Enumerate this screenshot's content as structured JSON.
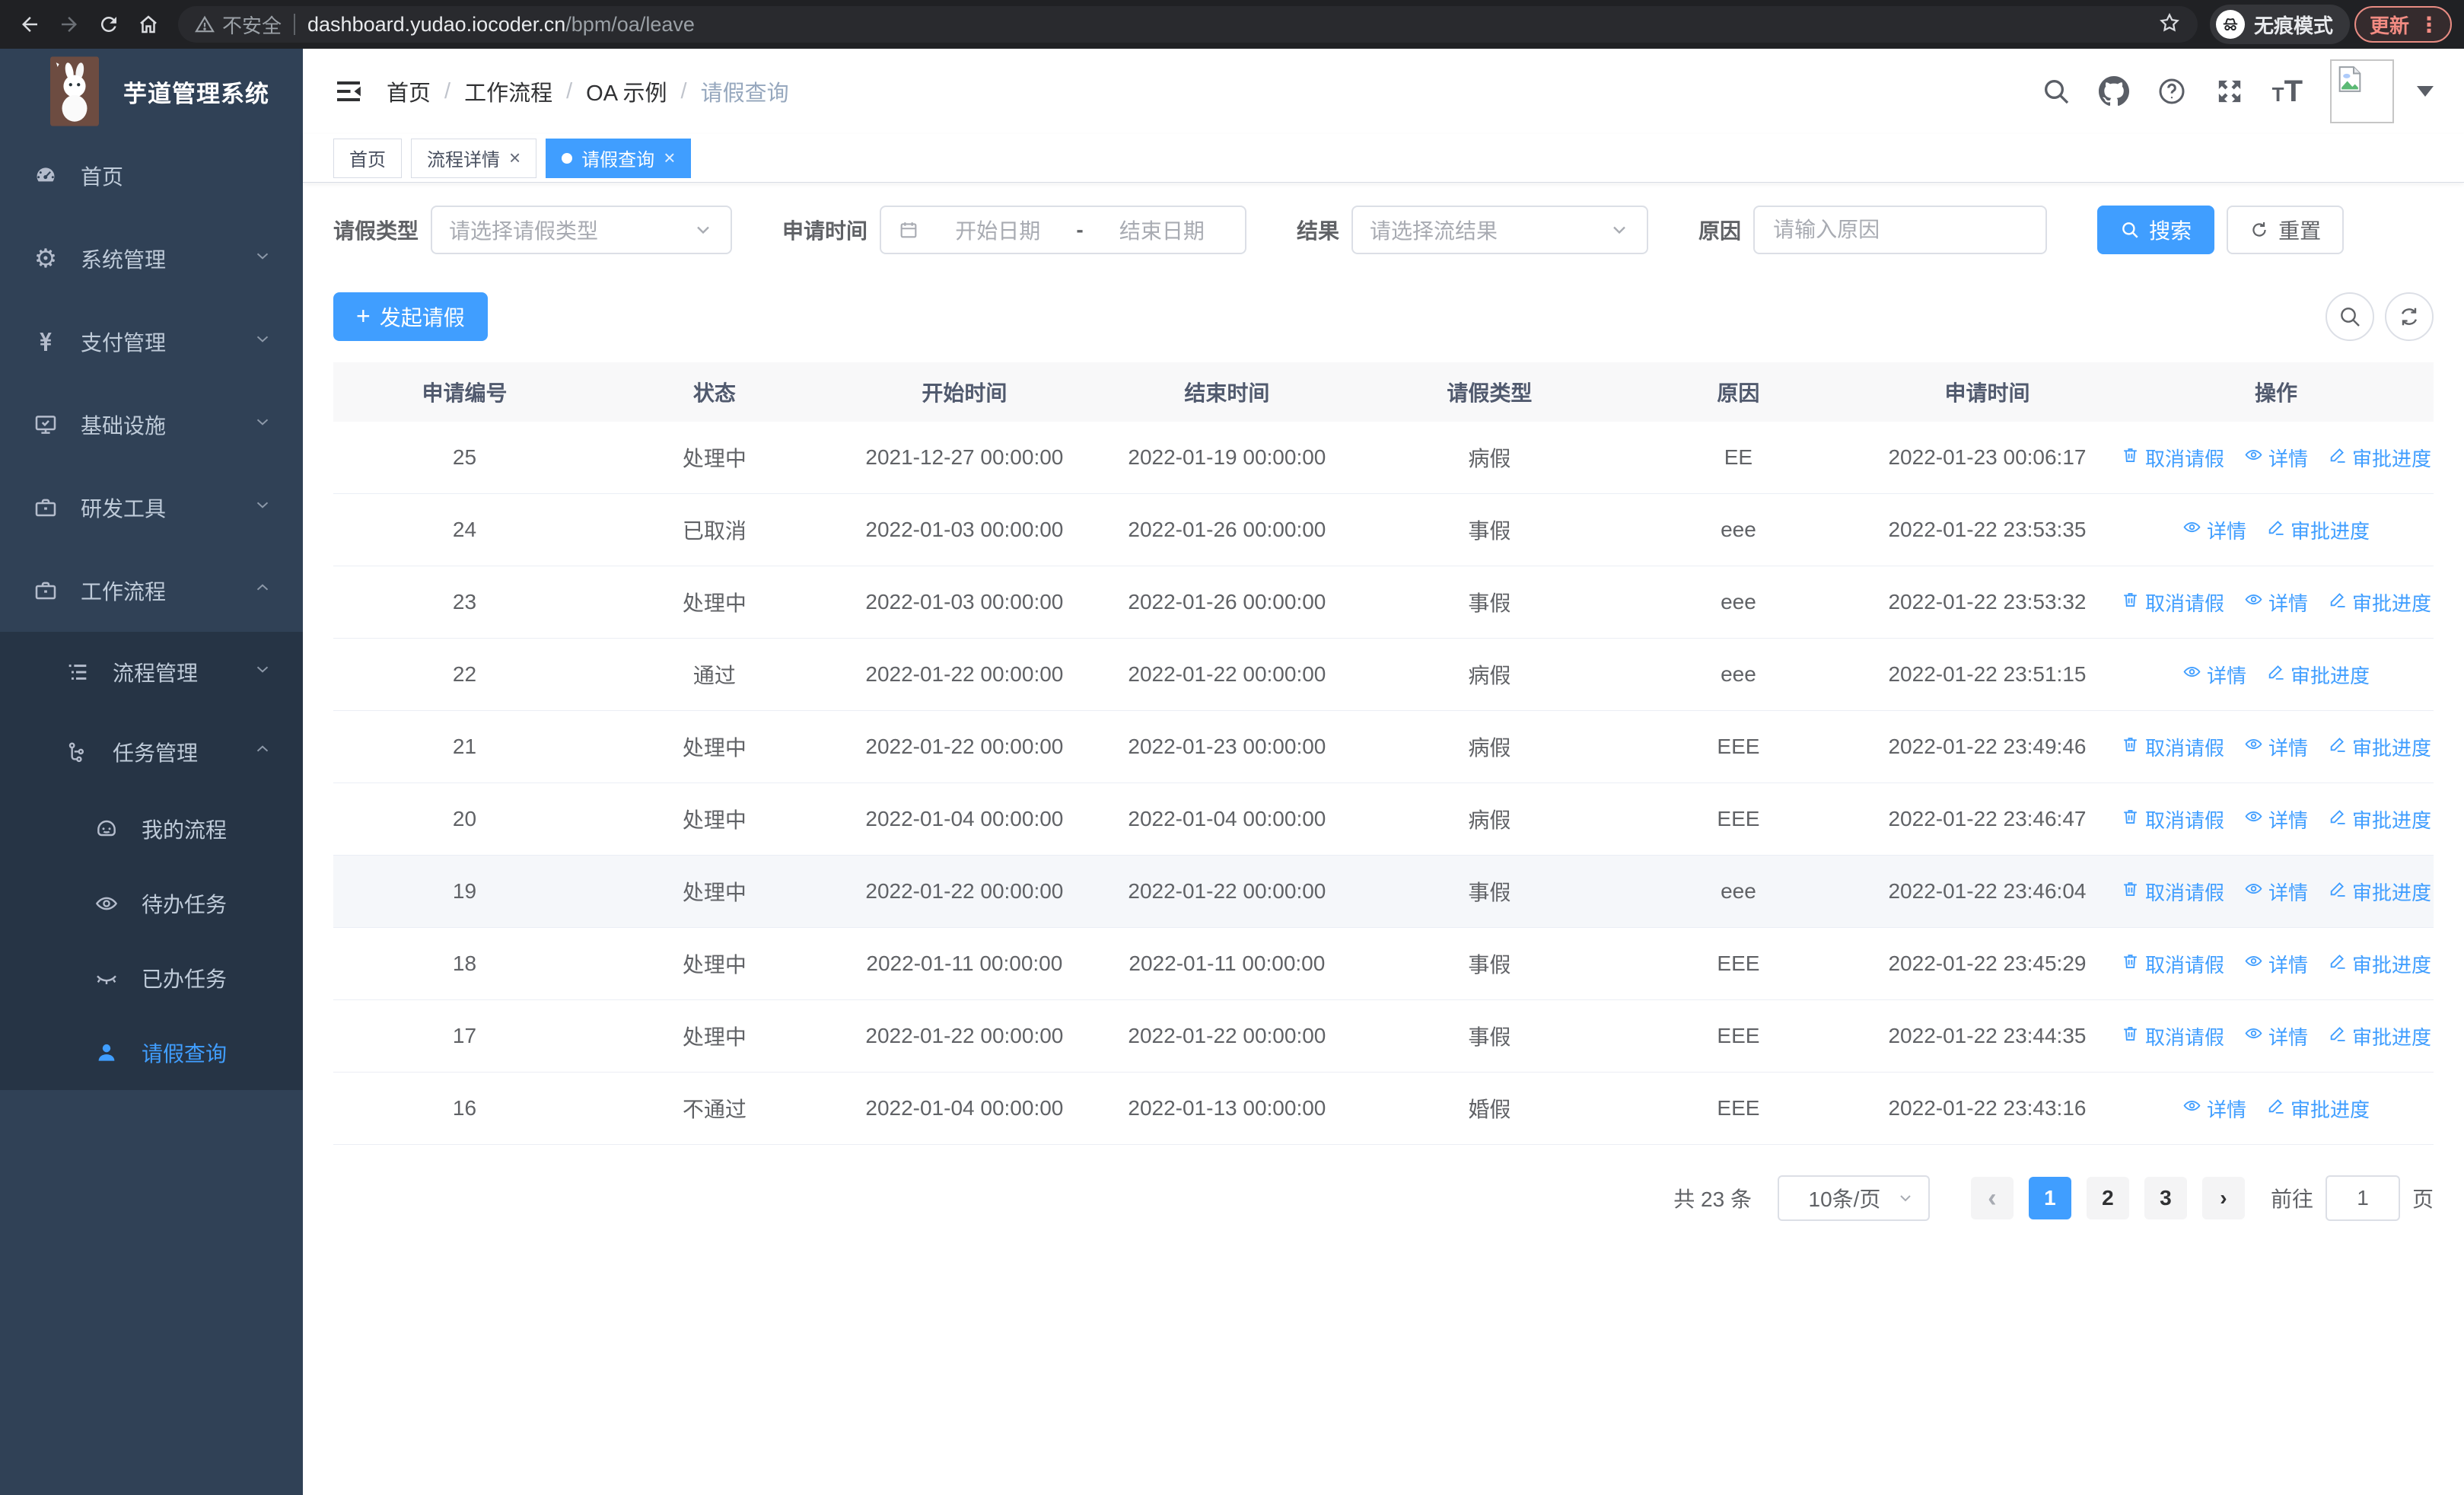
{
  "browser": {
    "security_warning": "不安全",
    "url_host": "dashboard.yudao.iocoder.cn",
    "url_path": "/bpm/oa/leave",
    "incognito_label": "无痕模式",
    "update_label": "更新",
    "menu_dots": "⋮"
  },
  "app": {
    "logo_title": "芋道管理系统",
    "breadcrumb": [
      "首页",
      "工作流程",
      "OA 示例",
      "请假查询"
    ],
    "tabs": [
      {
        "label": "首页",
        "closable": false,
        "active": false
      },
      {
        "label": "流程详情",
        "closable": true,
        "active": false
      },
      {
        "label": "请假查询",
        "closable": true,
        "active": true
      }
    ]
  },
  "sidebar": {
    "items": [
      {
        "label": "首页",
        "icon": "dashboard-icon",
        "level": 1,
        "arrow": "",
        "active": false
      },
      {
        "label": "系统管理",
        "icon": "gear-icon",
        "level": 1,
        "arrow": "down",
        "active": false
      },
      {
        "label": "支付管理",
        "icon": "yen-icon",
        "level": 1,
        "arrow": "down",
        "active": false
      },
      {
        "label": "基础设施",
        "icon": "monitor-icon",
        "level": 1,
        "arrow": "down",
        "active": false
      },
      {
        "label": "研发工具",
        "icon": "briefcase-icon",
        "level": 1,
        "arrow": "down",
        "active": false
      },
      {
        "label": "工作流程",
        "icon": "briefcase-icon",
        "level": 1,
        "arrow": "up",
        "active": false
      },
      {
        "label": "流程管理",
        "icon": "list-icon",
        "level": 2,
        "arrow": "down",
        "active": false
      },
      {
        "label": "任务管理",
        "icon": "tree-icon",
        "level": 2,
        "arrow": "up",
        "active": false
      },
      {
        "label": "我的流程",
        "icon": "face-icon",
        "level": 3,
        "arrow": "",
        "active": false
      },
      {
        "label": "待办任务",
        "icon": "eye-open-icon",
        "level": 3,
        "arrow": "",
        "active": false
      },
      {
        "label": "已办任务",
        "icon": "eye-closed-icon",
        "level": 3,
        "arrow": "",
        "active": false
      },
      {
        "label": "请假查询",
        "icon": "user-icon",
        "level": 3,
        "arrow": "",
        "active": true
      }
    ]
  },
  "filters": {
    "leave_type_label": "请假类型",
    "leave_type_placeholder": "请选择请假类型",
    "apply_time_label": "申请时间",
    "start_placeholder": "开始日期",
    "range_separator": "-",
    "end_placeholder": "结束日期",
    "result_label": "结果",
    "result_placeholder": "请选择流结果",
    "reason_label": "原因",
    "reason_placeholder": "请输入原因",
    "search_button": "搜索",
    "reset_button": "重置"
  },
  "toolbar": {
    "create_button": "发起请假"
  },
  "table": {
    "columns": [
      "申请编号",
      "状态",
      "开始时间",
      "结束时间",
      "请假类型",
      "原因",
      "申请时间",
      "操作"
    ],
    "action_labels": {
      "cancel": "取消请假",
      "detail": "详情",
      "progress": "审批进度"
    },
    "rows": [
      {
        "id": "25",
        "status": "处理中",
        "start": "2021-12-27 00:00:00",
        "end": "2022-01-19 00:00:00",
        "type": "病假",
        "reason": "EE",
        "applied": "2022-01-23 00:06:17",
        "actions": [
          "cancel",
          "detail",
          "progress"
        ],
        "highlight": false
      },
      {
        "id": "24",
        "status": "已取消",
        "start": "2022-01-03 00:00:00",
        "end": "2022-01-26 00:00:00",
        "type": "事假",
        "reason": "eee",
        "applied": "2022-01-22 23:53:35",
        "actions": [
          "detail",
          "progress"
        ],
        "highlight": false
      },
      {
        "id": "23",
        "status": "处理中",
        "start": "2022-01-03 00:00:00",
        "end": "2022-01-26 00:00:00",
        "type": "事假",
        "reason": "eee",
        "applied": "2022-01-22 23:53:32",
        "actions": [
          "cancel",
          "detail",
          "progress"
        ],
        "highlight": false
      },
      {
        "id": "22",
        "status": "通过",
        "start": "2022-01-22 00:00:00",
        "end": "2022-01-22 00:00:00",
        "type": "病假",
        "reason": "eee",
        "applied": "2022-01-22 23:51:15",
        "actions": [
          "detail",
          "progress"
        ],
        "highlight": false
      },
      {
        "id": "21",
        "status": "处理中",
        "start": "2022-01-22 00:00:00",
        "end": "2022-01-23 00:00:00",
        "type": "病假",
        "reason": "EEE",
        "applied": "2022-01-22 23:49:46",
        "actions": [
          "cancel",
          "detail",
          "progress"
        ],
        "highlight": false
      },
      {
        "id": "20",
        "status": "处理中",
        "start": "2022-01-04 00:00:00",
        "end": "2022-01-04 00:00:00",
        "type": "病假",
        "reason": "EEE",
        "applied": "2022-01-22 23:46:47",
        "actions": [
          "cancel",
          "detail",
          "progress"
        ],
        "highlight": false
      },
      {
        "id": "19",
        "status": "处理中",
        "start": "2022-01-22 00:00:00",
        "end": "2022-01-22 00:00:00",
        "type": "事假",
        "reason": "eee",
        "applied": "2022-01-22 23:46:04",
        "actions": [
          "cancel",
          "detail",
          "progress"
        ],
        "highlight": true
      },
      {
        "id": "18",
        "status": "处理中",
        "start": "2022-01-11 00:00:00",
        "end": "2022-01-11 00:00:00",
        "type": "事假",
        "reason": "EEE",
        "applied": "2022-01-22 23:45:29",
        "actions": [
          "cancel",
          "detail",
          "progress"
        ],
        "highlight": false
      },
      {
        "id": "17",
        "status": "处理中",
        "start": "2022-01-22 00:00:00",
        "end": "2022-01-22 00:00:00",
        "type": "事假",
        "reason": "EEE",
        "applied": "2022-01-22 23:44:35",
        "actions": [
          "cancel",
          "detail",
          "progress"
        ],
        "highlight": false
      },
      {
        "id": "16",
        "status": "不通过",
        "start": "2022-01-04 00:00:00",
        "end": "2022-01-13 00:00:00",
        "type": "婚假",
        "reason": "EEE",
        "applied": "2022-01-22 23:43:16",
        "actions": [
          "detail",
          "progress"
        ],
        "highlight": false
      }
    ]
  },
  "pagination": {
    "total_text": "共 23 条",
    "page_size": "10条/页",
    "prev": "‹",
    "next": "›",
    "pages": [
      "1",
      "2",
      "3"
    ],
    "active_page": "1",
    "goto_label": "前往",
    "goto_value": "1",
    "page_suffix": "页"
  },
  "colors": {
    "primary": "#409eff",
    "sidebar_bg": "#304156",
    "submenu_bg": "#263445",
    "table_header_bg": "#f8f8f9",
    "row_highlight": "#f5f7fa",
    "chrome_bg": "#202124",
    "update_red": "#f28b82"
  }
}
